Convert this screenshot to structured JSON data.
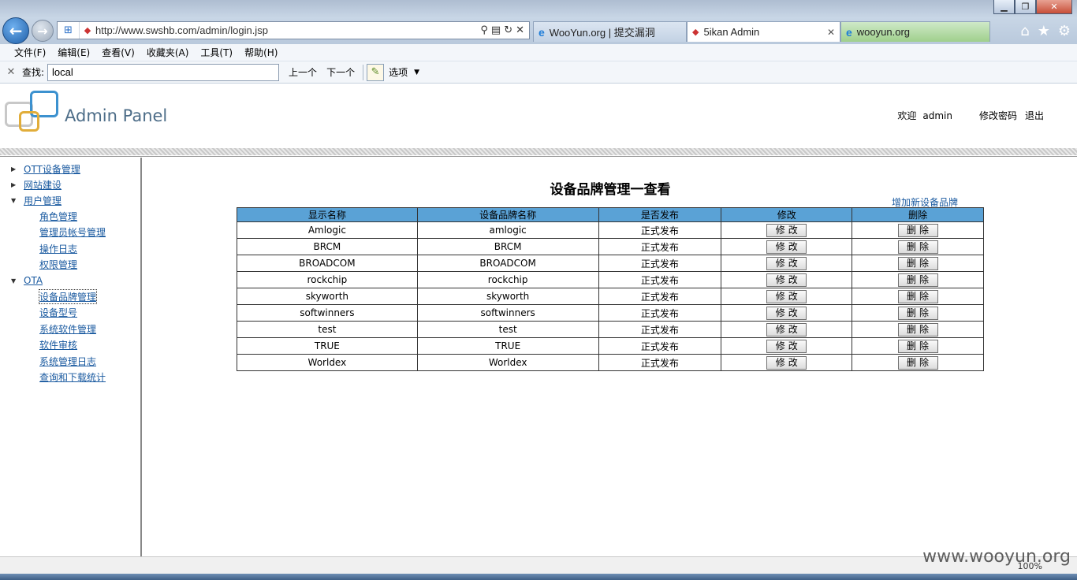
{
  "browser": {
    "url": "http://www.swshb.com/admin/login.jsp",
    "tabs": [
      {
        "label": "WooYun.org | 提交漏洞"
      },
      {
        "label": "5ikan Admin",
        "close": "✕"
      },
      {
        "label": "wooyun.org"
      }
    ],
    "menu": [
      "文件(F)",
      "编辑(E)",
      "查看(V)",
      "收藏夹(A)",
      "工具(T)",
      "帮助(H)"
    ],
    "find": {
      "label": "查找:",
      "value": "local",
      "prev": "上一个",
      "next": "下一个",
      "options": "选项"
    },
    "zoom": "100%"
  },
  "header": {
    "brand": "Admin Panel",
    "welcome_label": "欢迎",
    "username": "admin",
    "change_password": "修改密码",
    "logout": "退出"
  },
  "sidebar": {
    "nodes": [
      {
        "label": "OTT设备管理",
        "expanded": false,
        "children": []
      },
      {
        "label": "网站建设",
        "expanded": false,
        "children": []
      },
      {
        "label": "用户管理",
        "expanded": true,
        "children": [
          "角色管理",
          "管理员帐号管理",
          "操作日志",
          "权限管理"
        ]
      },
      {
        "label": "OTA",
        "expanded": true,
        "children": [
          "设备品牌管理",
          "设备型号",
          "系统软件管理",
          "软件审核",
          "系统管理日志",
          "查询和下载统计"
        ]
      }
    ],
    "selected": "设备品牌管理"
  },
  "main": {
    "title": "设备品牌管理一查看",
    "add_link": "增加新设备品牌",
    "columns": [
      "显示名称",
      "设备品牌名称",
      "是否发布",
      "修改",
      "删除"
    ],
    "edit_label": "修改",
    "delete_label": "删除",
    "rows": [
      {
        "display": "Amlogic",
        "brand": "amlogic",
        "status": "正式发布"
      },
      {
        "display": "BRCM",
        "brand": "BRCM",
        "status": "正式发布"
      },
      {
        "display": "BROADCOM",
        "brand": "BROADCOM",
        "status": "正式发布"
      },
      {
        "display": "rockchip",
        "brand": "rockchip",
        "status": "正式发布"
      },
      {
        "display": "skyworth",
        "brand": "skyworth",
        "status": "正式发布"
      },
      {
        "display": "softwinners",
        "brand": "softwinners",
        "status": "正式发布"
      },
      {
        "display": "test",
        "brand": "test",
        "status": "正式发布"
      },
      {
        "display": "TRUE",
        "brand": "TRUE",
        "status": "正式发布"
      },
      {
        "display": "Worldex",
        "brand": "Worldex",
        "status": "正式发布"
      }
    ]
  },
  "watermark": "www.wooyun.org"
}
